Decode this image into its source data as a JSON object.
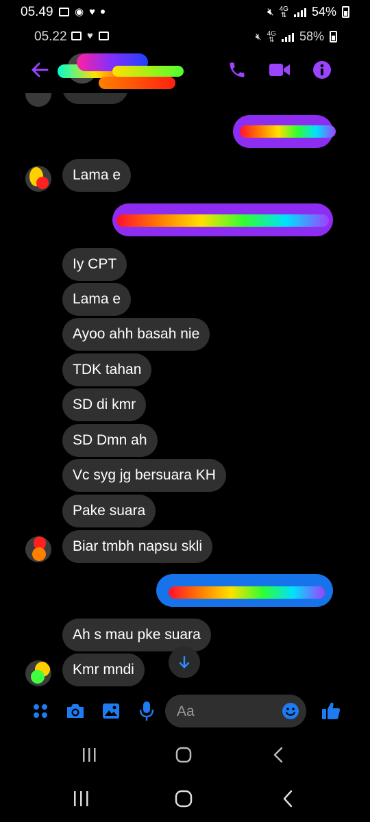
{
  "status_outer": {
    "time": "05.49",
    "battery": "54%",
    "network": "4G"
  },
  "status_inner": {
    "time": "05.22",
    "battery": "58%",
    "network": "4G"
  },
  "header": {
    "contact_name": "",
    "accent": "#9a44ff"
  },
  "messages": [
    {
      "dir": "in",
      "text": "Lama e"
    },
    {
      "dir": "in",
      "text": "Iy CPT"
    },
    {
      "dir": "in",
      "text": "Lama e"
    },
    {
      "dir": "in",
      "text": "Ayoo ahh basah nie"
    },
    {
      "dir": "in",
      "text": "TDK tahan"
    },
    {
      "dir": "in",
      "text": "SD di kmr"
    },
    {
      "dir": "in",
      "text": "SD Dmn ah"
    },
    {
      "dir": "in",
      "text": "Vc syg jg bersuara KH"
    },
    {
      "dir": "in",
      "text": "Pake suara"
    },
    {
      "dir": "in",
      "text": "Biar tmbh napsu skli"
    },
    {
      "dir": "in",
      "text": "Ah s mau pke suara"
    },
    {
      "dir": "in",
      "text": "Kmr mndi"
    }
  ],
  "composer": {
    "placeholder": "Aa"
  },
  "icons": {
    "back": "back-arrow-icon",
    "call": "phone-icon",
    "video": "video-camera-icon",
    "info": "info-icon",
    "apps": "apps-icon",
    "camera": "camera-icon",
    "gallery": "gallery-icon",
    "mic": "microphone-icon",
    "emoji": "emoji-icon",
    "like": "thumbs-up-icon",
    "scroll": "scroll-down-icon"
  },
  "colors": {
    "blue": "#1773ea",
    "purple": "#8e2df2",
    "bubble_in": "#303030",
    "accent": "#9a44ff"
  }
}
